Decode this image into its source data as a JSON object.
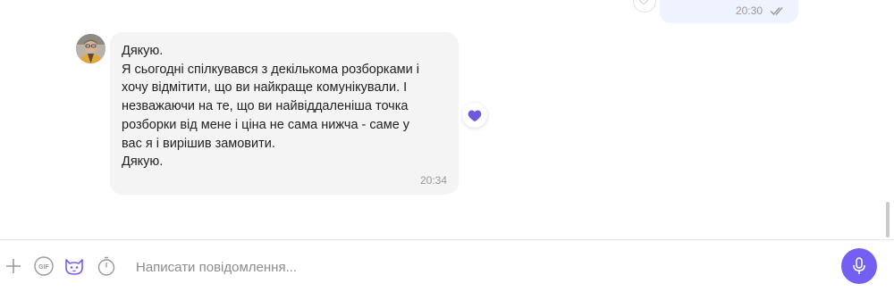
{
  "previous_message": {
    "time": "20:30",
    "status_icon": "double-check-icon"
  },
  "incoming_message": {
    "lines": [
      "Дякую.",
      "Я сьогодні спілкувався з декількома розборками і",
      "хочу відмітити, що ви найкраще комунікували. І",
      "незважаючи на те, що ви найвіддаленіша точка",
      "розборки від мене і ціна не сама нижча - саме у",
      "вас я і вирішив замовити.",
      "Дякую."
    ],
    "time": "20:34",
    "reaction_icon": "heart-icon"
  },
  "composer": {
    "placeholder": "Написати повідомлення...",
    "icons": [
      "plus-icon",
      "gif-icon",
      "sticker-icon",
      "timer-icon",
      "microphone-icon"
    ]
  },
  "colors": {
    "accent": "#7360f2",
    "incoming_bubble": "#f4f4f4",
    "outgoing_bubble": "#eef3ff",
    "heart": "#6e5ad8"
  }
}
